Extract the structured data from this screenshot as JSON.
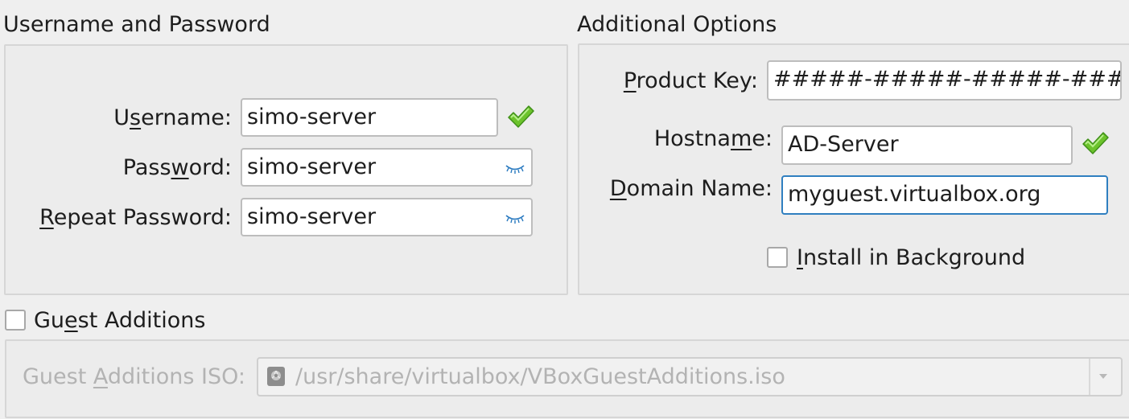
{
  "credentials": {
    "title": "Username and Password",
    "username_label_a": "U",
    "username_label_u": "s",
    "username_label_b": "ername:",
    "username_value": "simo-server",
    "password_label_a": "Pass",
    "password_label_u": "w",
    "password_label_b": "ord:",
    "password_value": "simo-server",
    "repeat_label_u": "R",
    "repeat_label_b": "epeat Password:",
    "repeat_value": "simo-server"
  },
  "options": {
    "title": "Additional Options",
    "product_key_label_u": "P",
    "product_key_label_b": "roduct Key:",
    "product_key_value": "#####-#####-#####-#####-",
    "hostname_label_a": "Hostna",
    "hostname_label_u": "m",
    "hostname_label_b": "e:",
    "hostname_value": "AD-Server",
    "domain_label_u": "D",
    "domain_label_b": "omain Name:",
    "domain_value": "myguest.virtualbox.org",
    "install_bg_label_u": "I",
    "install_bg_label_b": "nstall in Background"
  },
  "guest_additions": {
    "checkbox_label_a": "Gu",
    "checkbox_label_u": "e",
    "checkbox_label_b": "st Additions",
    "iso_label_a": "Guest ",
    "iso_label_u": "A",
    "iso_label_b": "dditions ISO:",
    "iso_path": "/usr/share/virtualbox/VBoxGuestAdditions.iso"
  },
  "colors": {
    "valid_check": "#6cc32c",
    "focus_border": "#2f7fc0",
    "eye_icon": "#2a7ac0"
  }
}
